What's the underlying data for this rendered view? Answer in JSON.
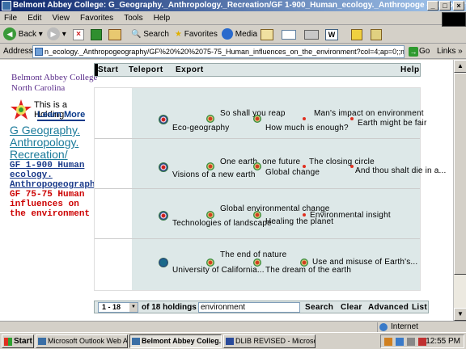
{
  "window": {
    "title": "Belmont Abbey College: G_Geography._Anthropology._Recreation/GF 1-900_Human_ecology._Anthropoge - Microsoft Internet..."
  },
  "menu": [
    "File",
    "Edit",
    "View",
    "Favorites",
    "Tools",
    "Help"
  ],
  "toolbar": {
    "back": "Back",
    "search": "Search",
    "favorites": "Favorites",
    "media": "Media"
  },
  "address": {
    "label": "Address",
    "url": "n_ecology._Anthropogeography/GF%20%20%2075-75_Human_influences_on_the_environment?col=4;ap=0;;ms=20;st=0",
    "go": "Go",
    "links": "Links"
  },
  "page": {
    "college_line1": "Belmont Abbey College",
    "college_line2": "North Carolina",
    "holding_text": "This is a Holding",
    "learn_more": "Learn More",
    "crumb1": "G Geography. Anthropology. Recreation/",
    "crumb2": "GF 1-900 Human ecology. Anthropogeography/",
    "crumb3": "GF 75-75 Human influences on the environment",
    "nav": {
      "start": "Start",
      "teleport": "Teleport",
      "export": "Export",
      "help": "Help"
    },
    "rows": [
      {
        "a": "Eco-geography",
        "b": "So shall you reap",
        "c": "How much is enough?",
        "d": "Man's impact on environment",
        "e": "Earth might be fair"
      },
      {
        "a": "Visions of a new earth",
        "b": "One earth, one future",
        "c": "Global change",
        "d": "The closing circle",
        "e": "And thou shalt die in a..."
      },
      {
        "a": "Technologies of landscape",
        "b": "Global environmental change",
        "c": "Healing the planet",
        "d": "Environmental insight"
      },
      {
        "a": "University of California...",
        "b": "The end of nature",
        "c": "The dream of the earth",
        "d": "Use and misuse of Earth's..."
      }
    ],
    "bottom": {
      "range": "1 - 18",
      "count": "of 18 holdings",
      "query": "environment",
      "search": "Search",
      "clear": "Clear",
      "advanced": "Advanced",
      "list": "List"
    }
  },
  "status": {
    "zone": "Internet"
  },
  "taskbar": {
    "start": "Start",
    "tasks": [
      "Microsoft Outlook Web A...",
      "Belmont Abbey Colleg...",
      "DLIB REVISED - Microsof..."
    ],
    "clock": "12:55 PM"
  }
}
